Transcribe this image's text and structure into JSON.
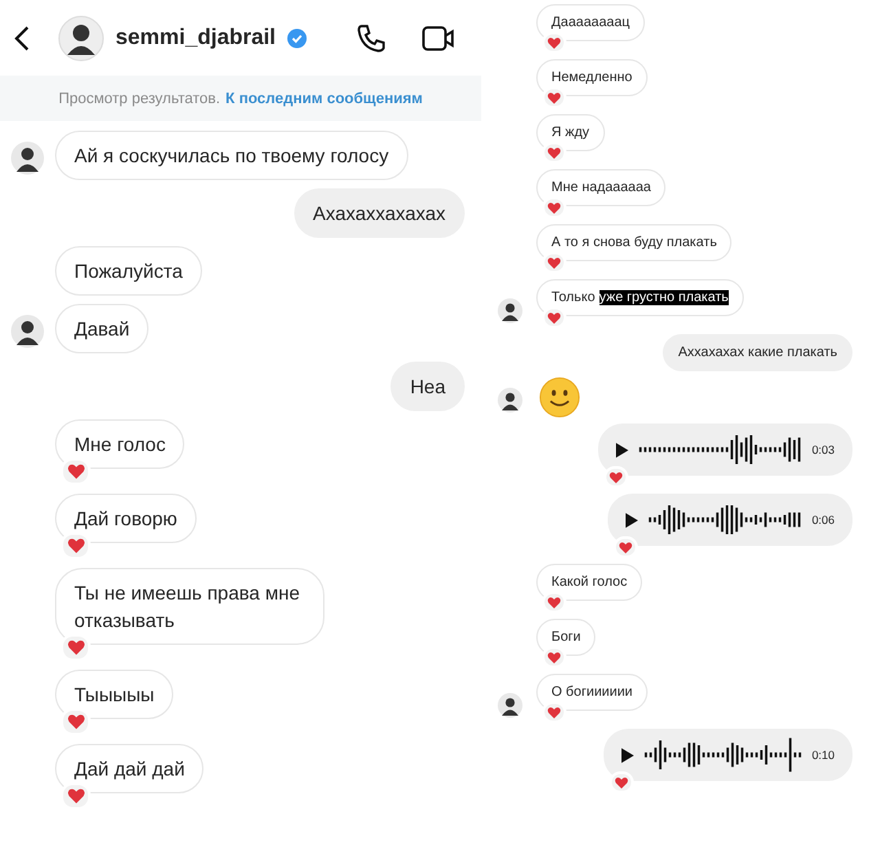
{
  "left": {
    "header": {
      "username": "semmi_djabrail",
      "verified": true
    },
    "banner": {
      "text": "Просмотр результатов.",
      "link": "К последним сообщениям"
    },
    "messages": [
      {
        "kind": "text",
        "sent": false,
        "text": "Ай я соскучилась по твоему голосу",
        "avatar": true,
        "liked": false
      },
      {
        "kind": "text",
        "sent": true,
        "text": "Ахахаххахахах",
        "liked": false
      },
      {
        "kind": "text",
        "sent": false,
        "text": "Пожалуйста",
        "avatar": false,
        "liked": false
      },
      {
        "kind": "text",
        "sent": false,
        "text": "Давай",
        "avatar": true,
        "liked": false
      },
      {
        "kind": "text",
        "sent": true,
        "text": "Неа",
        "liked": false
      },
      {
        "kind": "text",
        "sent": false,
        "text": "Мне голос",
        "avatar": false,
        "liked": true
      },
      {
        "kind": "text",
        "sent": false,
        "text": "Дай говорю",
        "avatar": false,
        "liked": true
      },
      {
        "kind": "text",
        "sent": false,
        "text": "Ты не имеешь права мне отказывать",
        "avatar": false,
        "liked": true
      },
      {
        "kind": "text",
        "sent": false,
        "text": "Тыыыыы",
        "avatar": false,
        "liked": true
      },
      {
        "kind": "text",
        "sent": false,
        "text": "Дай дай дай",
        "avatar": false,
        "liked": true
      }
    ]
  },
  "right": {
    "messages": [
      {
        "kind": "text",
        "sent": false,
        "text": "Даааааааац",
        "avatar": false,
        "liked": true
      },
      {
        "kind": "text",
        "sent": false,
        "text": "Немедленно",
        "avatar": false,
        "liked": true
      },
      {
        "kind": "text",
        "sent": false,
        "text": "Я жду",
        "avatar": false,
        "liked": true
      },
      {
        "kind": "text",
        "sent": false,
        "text": "Мне надаааааа",
        "avatar": false,
        "liked": true
      },
      {
        "kind": "text",
        "sent": false,
        "text": "А то я снова буду плакать",
        "avatar": false,
        "liked": true
      },
      {
        "kind": "text",
        "sent": false,
        "text": "Только",
        "highlight": "уже грустно плакать",
        "avatar": true,
        "liked": true
      },
      {
        "kind": "text",
        "sent": true,
        "text": "Аххахахах какие плакать",
        "liked": false
      },
      {
        "kind": "emoji",
        "sent": false,
        "avatar": true,
        "liked": false
      },
      {
        "kind": "voice",
        "sent": true,
        "duration": "0:03",
        "liked": true
      },
      {
        "kind": "voice",
        "sent": true,
        "duration": "0:06",
        "liked": true
      },
      {
        "kind": "text",
        "sent": false,
        "text": "Какой голос",
        "avatar": false,
        "liked": true
      },
      {
        "kind": "text",
        "sent": false,
        "text": "Боги",
        "avatar": false,
        "liked": true
      },
      {
        "kind": "text",
        "sent": false,
        "text": "О богииииии",
        "avatar": true,
        "liked": true
      },
      {
        "kind": "voice",
        "sent": true,
        "duration": "0:10",
        "liked": true
      }
    ]
  }
}
